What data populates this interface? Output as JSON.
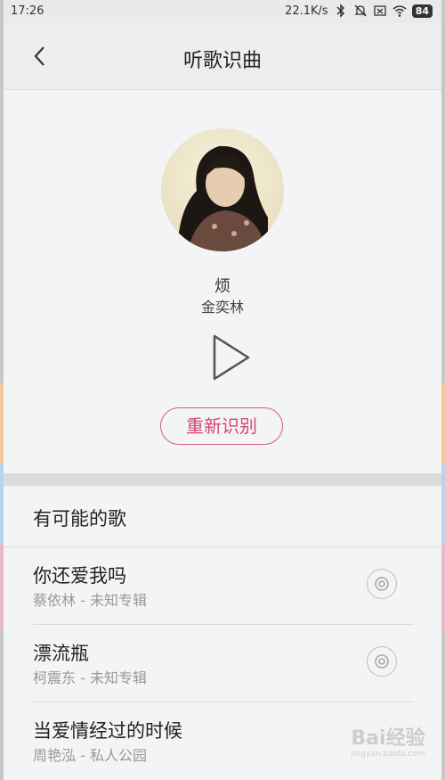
{
  "status_bar": {
    "time": "17:26",
    "speed": "22.1K/s",
    "battery": "84",
    "icons": [
      "bluetooth-icon",
      "mute-icon",
      "sim-x-icon",
      "wifi-icon",
      "battery-icon"
    ]
  },
  "header": {
    "title": "听歌识曲",
    "back_icon": "chevron-left-icon"
  },
  "result": {
    "song": "烦",
    "artist": "金奕林",
    "play_icon": "play-icon",
    "retry_label": "重新识别"
  },
  "suggestions": {
    "title": "有可能的歌",
    "items": [
      {
        "title": "你还爱我吗",
        "artist": "蔡依林",
        "album": "未知专辑"
      },
      {
        "title": "漂流瓶",
        "artist": "柯震东",
        "album": "未知专辑"
      },
      {
        "title": "当爱情经过的时候",
        "artist": "周艳泓",
        "album": "私人公园"
      }
    ],
    "separator": " - "
  },
  "watermark": {
    "line1": "Bai",
    "line2": "经验",
    "line3": "jingyan.baidu.com"
  },
  "colors": {
    "accent": "#d8466f",
    "background": "#f3f4f6",
    "secondary_text": "#999999"
  }
}
